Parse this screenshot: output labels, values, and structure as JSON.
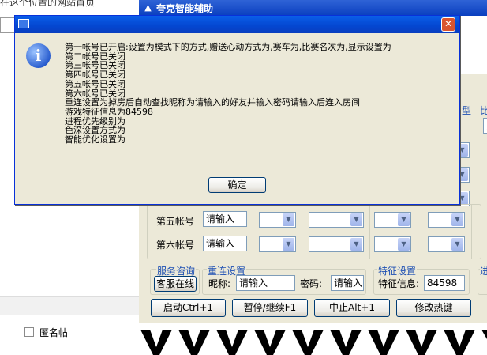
{
  "background_window": {
    "top_text": "在这个位置的网站首页",
    "anonymous_label": "匿名帖"
  },
  "assistant": {
    "title": "夸克智能辅助",
    "partial_headers": [
      "型",
      "比"
    ],
    "partial_right_value": "第",
    "accounts": [
      {
        "label": "第五帐号",
        "input_value": "请输入"
      },
      {
        "label": "第六帐号",
        "input_value": "请输入"
      }
    ],
    "service": {
      "title": "服务咨询",
      "button_label": "客服在线"
    },
    "reconnect": {
      "title": "重连设置",
      "nickname_label": "昵称:",
      "nickname_value": "请输入",
      "password_label": "密码:",
      "password_value": "请输入"
    },
    "feature": {
      "title": "特征设置",
      "info_label": "特征信息:",
      "info_value": "84598"
    },
    "partial_right_group": "进",
    "buttons": {
      "start": "启动Ctrl+1",
      "pause": "暂停/继续F1",
      "stop": "中止Alt+1",
      "hotkey": "修改热键"
    }
  },
  "dialog": {
    "message_lines": [
      "第一帐号已开启:设置为模式下的方式,赠送心动方式为,赛车为,比赛名次为,显示设置为",
      "第二帐号已关闭",
      "第三帐号已关闭",
      "第四帐号已关闭",
      "第五帐号已关闭",
      "第六帐号已关闭",
      "重连设置为掉房后自动查找昵称为请输入的好友并输入密码请输入后连入房间",
      "游戏特征信息为84598",
      "进程优先级别为",
      "色深设置方式为",
      "智能优化设置为"
    ],
    "ok_label": "确定",
    "close_symbol": "✕",
    "info_symbol": "i"
  },
  "icons": {
    "title_app": "up-arrow-icon",
    "dialog_info": "info-icon",
    "dialog_close": "close-icon",
    "dropdown": "chevron-down-icon"
  },
  "colors": {
    "title_bar": "#0a3fbf",
    "dialog_bg": "#ece9d8",
    "close_button": "#d9542f",
    "section_title": "#1d4fb3"
  }
}
